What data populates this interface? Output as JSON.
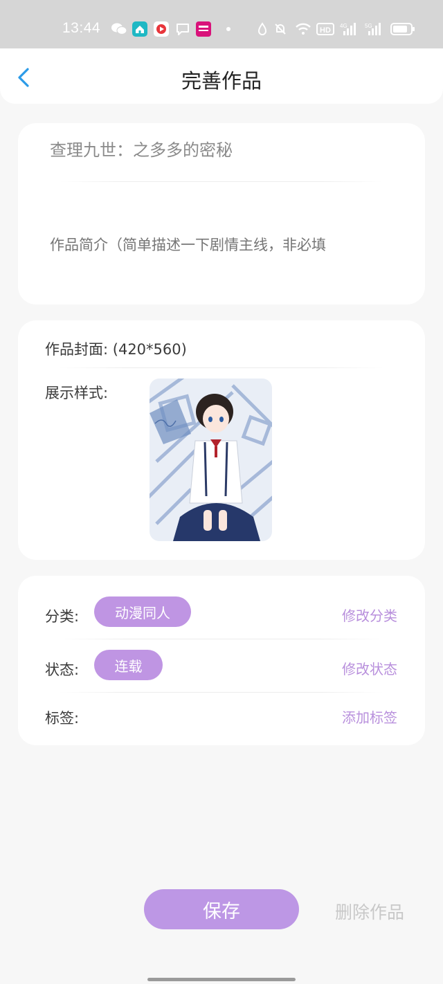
{
  "status_bar": {
    "time": "13:44",
    "network_1": "4G",
    "network_2": "5G",
    "hd": "HD"
  },
  "header": {
    "title": "完善作品"
  },
  "work": {
    "title_value": "查理九世：之多多的密秘",
    "description_placeholder": "作品简介（简单描述一下剧情主线，非必填"
  },
  "cover": {
    "label": "作品封面:",
    "size_hint": "(420*560)",
    "style_label": "展示样式:"
  },
  "meta": {
    "category_label": "分类:",
    "category_value": "动漫同人",
    "category_action": "修改分类",
    "status_label": "状态:",
    "status_value": "连载",
    "status_action": "修改状态",
    "tags_label": "标签:",
    "tags_action": "添加标签"
  },
  "footer": {
    "save_label": "保存",
    "delete_label": "删除作品"
  },
  "colors": {
    "accent": "#bf95e3",
    "back_arrow": "#2b9be8"
  }
}
